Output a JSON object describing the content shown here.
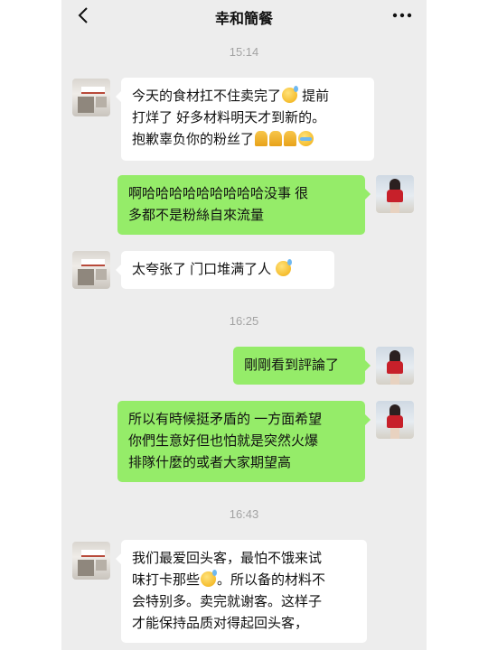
{
  "header": {
    "title": "幸和簡餐"
  },
  "colors": {
    "background": "#ededed",
    "bubble_sent": "#95ec69",
    "bubble_received": "#ffffff"
  },
  "icons": {
    "back": "chevron-left-icon",
    "more": "more-dots-icon",
    "emoji_sweat": "sweat-smile-emoji",
    "emoji_pray": "pray-emoji",
    "emoji_cry": "crying-emoji"
  },
  "chat": {
    "time1": "15:14",
    "msg1": {
      "line1a": "今天的食材扛不住卖完了",
      "line1b": " 提前",
      "line2": "打烊了  好多材料明天才到新的。",
      "line3": "抱歉辜负你的粉丝了"
    },
    "msg2": {
      "line1": "啊哈哈哈哈哈哈哈哈哈没事 很",
      "line2": "多都不是粉絲自來流量"
    },
    "msg3": {
      "line1": "太夸张了 门口堆满了人 "
    },
    "time2": "16:25",
    "msg4": {
      "line1": "剛剛看到評論了"
    },
    "msg5": {
      "line1": "所以有時候挺矛盾的 一方面希望",
      "line2": "你們生意好但也怕就是突然火爆",
      "line3": "排隊什麼的或者大家期望高"
    },
    "time3": "16:43",
    "msg6": {
      "line1": "我们最爱回头客，最怕不饿来试",
      "line2a": "味打卡那些",
      "line2b": "。所以备的材料不",
      "line3": "会特别多。卖完就谢客。这样子",
      "line4": "才能保持品质对得起回头客，"
    }
  }
}
